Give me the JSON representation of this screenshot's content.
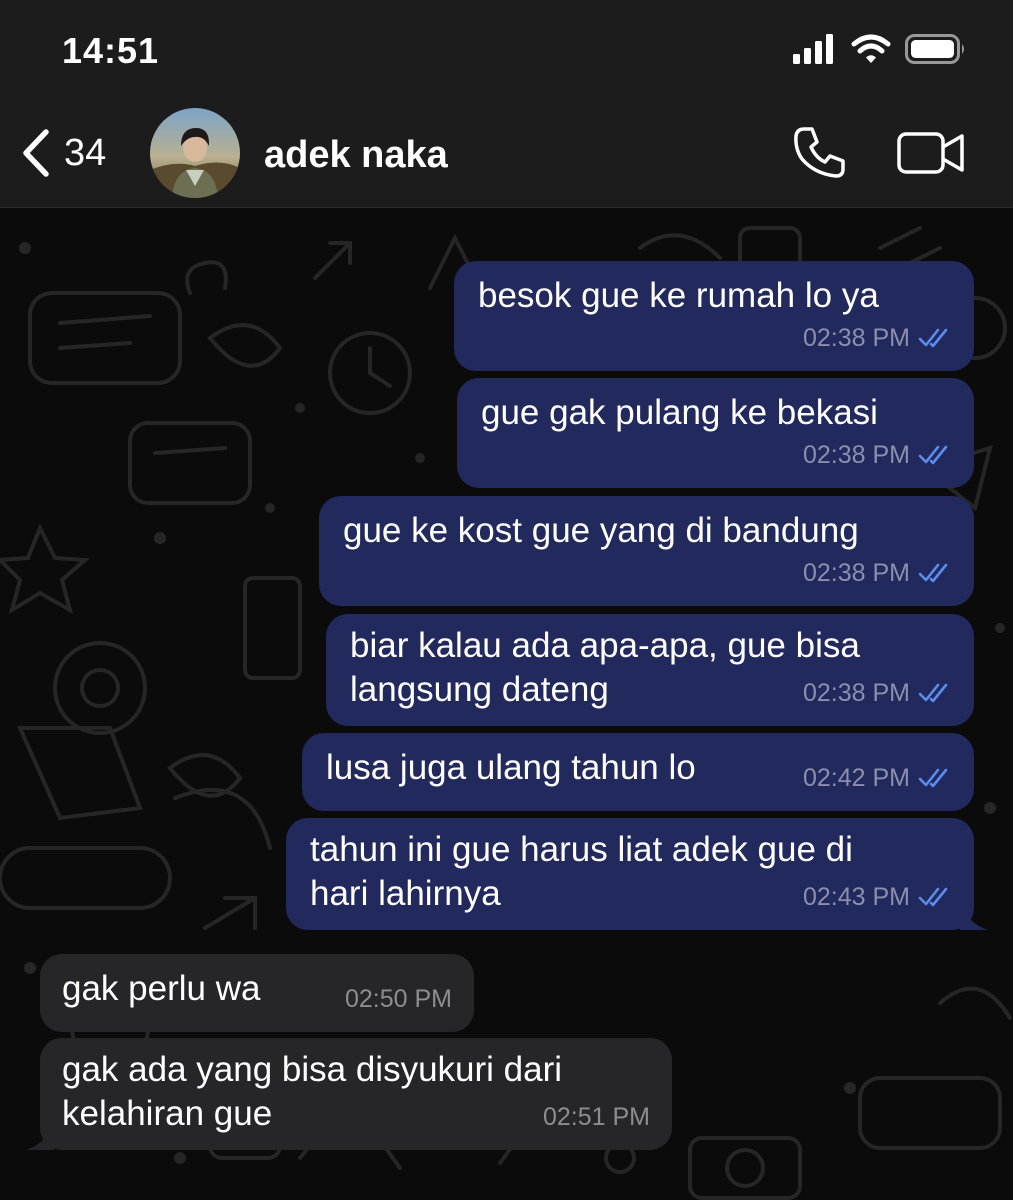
{
  "status_bar": {
    "time": "14:51"
  },
  "header": {
    "back_count": "34",
    "contact_name": "adek naka"
  },
  "messages": [
    {
      "text": "besok gue ke rumah lo ya",
      "time": "02:38 PM",
      "direction": "out",
      "status": "read"
    },
    {
      "text": "gue gak pulang ke bekasi",
      "time": "02:38 PM",
      "direction": "out",
      "status": "read"
    },
    {
      "text": "gue ke kost gue yang di bandung",
      "time": "02:38 PM",
      "direction": "out",
      "status": "read"
    },
    {
      "line1": "biar kalau ada apa-apa, gue bisa",
      "line2": "langsung dateng",
      "time": "02:38 PM",
      "direction": "out",
      "status": "read"
    },
    {
      "text": "lusa juga ulang tahun lo",
      "time": "02:42 PM",
      "direction": "out",
      "status": "read"
    },
    {
      "line1": "tahun ini gue harus liat adek gue di",
      "line2": "hari lahirnya",
      "time": "02:43 PM",
      "direction": "out",
      "status": "read"
    },
    {
      "text": "gak perlu wa",
      "time": "02:50 PM",
      "direction": "in"
    },
    {
      "line1": "gak ada yang bisa disyukuri dari",
      "line2": "kelahiran gue",
      "time": "02:51 PM",
      "direction": "in"
    }
  ],
  "colors": {
    "outgoing_bubble": "#22295c",
    "incoming_bubble": "#262628",
    "read_ticks": "#5b8dee",
    "header_bg": "#1c1c1d"
  },
  "icons": [
    "signal-icon",
    "wifi-icon",
    "battery-icon",
    "back-chevron-icon",
    "phone-icon",
    "video-camera-icon",
    "double-check-icon"
  ]
}
